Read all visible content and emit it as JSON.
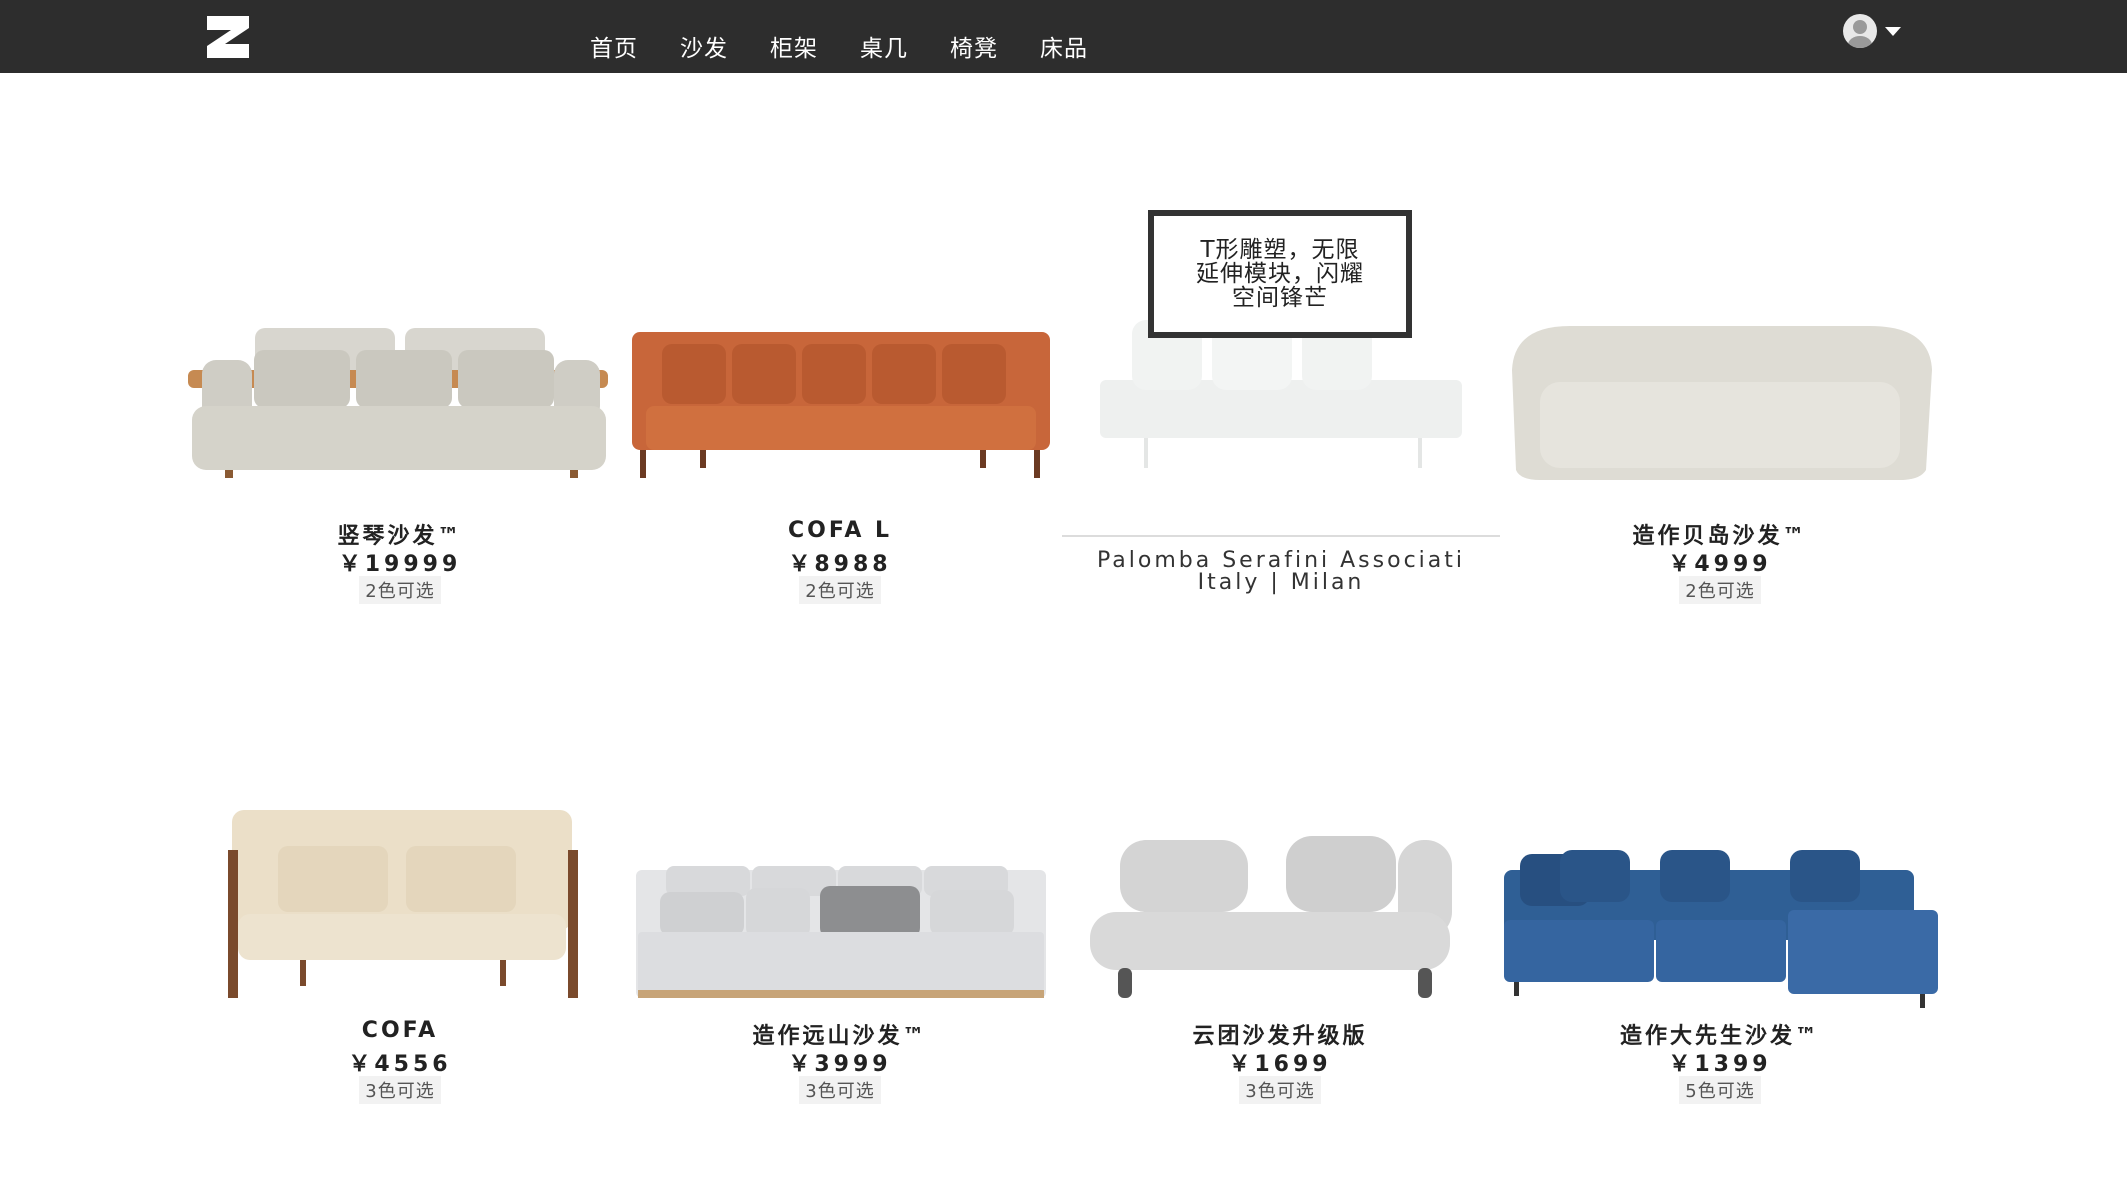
{
  "header": {
    "logo": "brand-logo",
    "nav": [
      "首页",
      "沙发",
      "柜架",
      "桌几",
      "椅凳",
      "床品"
    ],
    "user_icon": "avatar-icon",
    "dropdown_icon": "caret-down-icon"
  },
  "feature": {
    "caption_lines": [
      "T形雕塑，无限",
      "延伸模块，闪耀",
      "空间锋芒"
    ],
    "designer_lines": [
      "Palomba Serafini Associati",
      "Italy | Milan"
    ]
  },
  "products": [
    {
      "name": "竖琴沙发™",
      "price": "￥19999",
      "colors": "2色可选"
    },
    {
      "name": "COFA L",
      "price": "￥8988",
      "colors": "2色可选"
    },
    {
      "name": "造作贝岛沙发™",
      "price": "￥4999",
      "colors": "2色可选"
    },
    {
      "name": "COFA",
      "price": "￥4556",
      "colors": "3色可选"
    },
    {
      "name": "造作远山沙发™",
      "price": "￥3999",
      "colors": "3色可选"
    },
    {
      "name": "云团沙发升级版",
      "price": "￥1699",
      "colors": "3色可选"
    },
    {
      "name": "造作大先生沙发™",
      "price": "￥1399",
      "colors": "5色可选"
    }
  ],
  "colors": {
    "header_bg": "#2d2d2d",
    "accent_blue": "#2f5f95",
    "accent_orange": "#c8663a"
  }
}
